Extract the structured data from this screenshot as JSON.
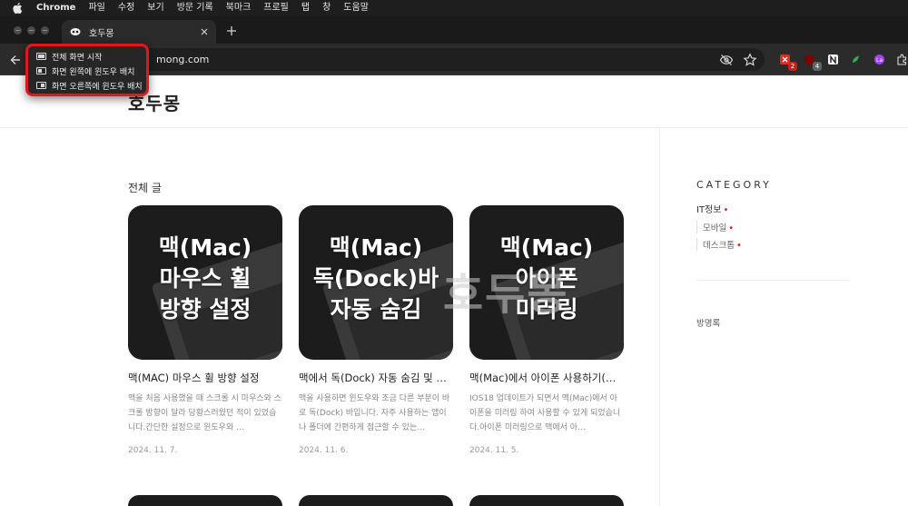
{
  "menubar": {
    "app_name": "Chrome",
    "items": [
      "파일",
      "수정",
      "보기",
      "방문 기록",
      "북마크",
      "프로필",
      "탭",
      "창",
      "도움말"
    ]
  },
  "tab": {
    "title": "호두몽"
  },
  "toolbar": {
    "url": "mong.com",
    "extensions": [
      {
        "name": "extension-red",
        "badge": "2",
        "color": "#d93025"
      },
      {
        "name": "extension-ublock",
        "badge": "4",
        "color": "#800000"
      },
      {
        "name": "extension-notion",
        "badge": "",
        "color": "#e8e8e8"
      },
      {
        "name": "extension-green",
        "badge": "",
        "color": "#34a853"
      },
      {
        "name": "extension-purple",
        "badge": "",
        "color": "#a142f4"
      },
      {
        "name": "extension-puzzle",
        "badge": "",
        "color": "#e8e8e8"
      }
    ]
  },
  "popup_menu": {
    "items": [
      {
        "label": "전체 화면 시작",
        "icon": "fullscreen-icon"
      },
      {
        "label": "화면 왼쪽에 윈도우 배치",
        "icon": "tile-left-icon"
      },
      {
        "label": "화면 오른쪽에 윈도우 배치",
        "icon": "tile-right-icon"
      }
    ]
  },
  "blog": {
    "name": "호두몽",
    "section_title": "전체 글",
    "watermark": "호두몽",
    "posts": [
      {
        "thumb_lines": [
          "맥(Mac)",
          "마우스 휠",
          "방향 설정"
        ],
        "title": "맥(MAC) 마우스 휠 방향 설정",
        "excerpt": "맥을 처음 사용했을 때 스크롤 시 마우스와 스크롤 방향이 달라 당황스러웠던 적이 있었습니다.간단한 설정으로 윈도우와 …",
        "date": "2024. 11. 7."
      },
      {
        "thumb_lines": [
          "맥(Mac)",
          "독(Dock)바",
          "자동 숨김"
        ],
        "title": "맥에서 독(Dock) 자동 숨김 및 …",
        "excerpt": "맥을 사용하면 윈도우와 조금 다른 부분이 바로 독(Dock) 바입니다. 자주 사용하는 앱이나 폴더에 간편하게 접근할 수 있는…",
        "date": "2024. 11. 6."
      },
      {
        "thumb_lines": [
          "맥(Mac)",
          "아이폰",
          "미러링"
        ],
        "title": "맥(Mac)에서 아이폰 사용하기(…",
        "excerpt": "IOS18 업데이트가 되면서 맥(Mac)에서 아이폰을 미러링 하여 사용할 수 있게 되었습니다.아이폰 미러링으로 맥에서 아…",
        "date": "2024. 11. 5."
      }
    ]
  },
  "sidebar": {
    "category_title": "CATEGORY",
    "main_category": "IT정보",
    "subcategories": [
      "모바일",
      "데스크톱"
    ],
    "guestbook": "방명록"
  },
  "colors": {
    "popup_border": "#e4161b",
    "category_dot": "#e4161b"
  }
}
